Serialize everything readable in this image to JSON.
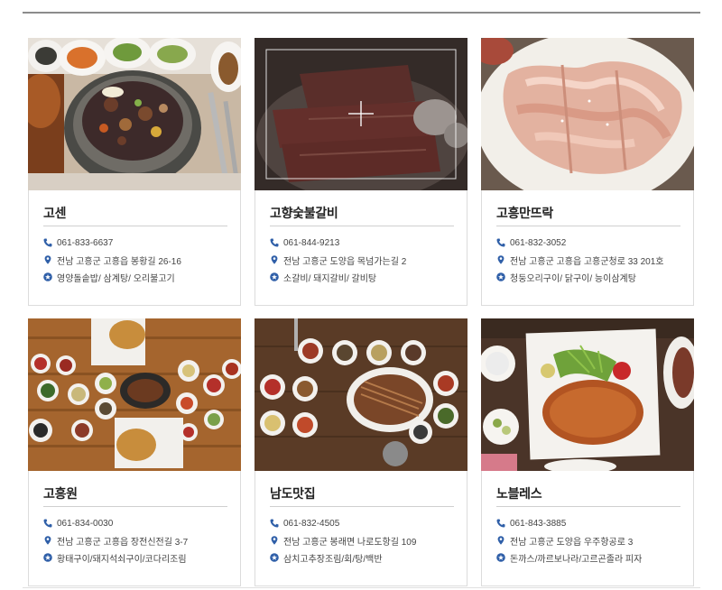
{
  "colors": {
    "accent": "#2f5fa8",
    "rule": "#8c8c8c",
    "border": "#dcdcdc"
  },
  "restaurants": [
    {
      "name": "고센",
      "phone": "061-833-6637",
      "address": "전남 고흥군 고흥읍 봉황길 26-16",
      "menu": "영양돌솥밥/ 삼계탕/ 오리불고기",
      "photo": "stone-pot-rice-photo"
    },
    {
      "name": "고향숯불갈비",
      "phone": "061-844-9213",
      "address": "전남 고흥군 도양읍 목넘가는길 2",
      "menu": "소갈비/ 돼지갈비/ 갈비탕",
      "photo": "raw-beef-ribs-photo"
    },
    {
      "name": "고흥만뜨락",
      "phone": "061-832-3052",
      "address": "전남 고흥군 고흥읍 고흥군청로 33 201호",
      "menu": "청둥오리구이/ 닭구이/ 능이삼계탕",
      "photo": "raw-duck-meat-photo"
    },
    {
      "name": "고흥원",
      "phone": "061-834-0030",
      "address": "전남 고흥군 고흥읍 장전신전길 3-7",
      "menu": "황태구이/돼지석쇠구이/코다리조림",
      "photo": "korean-table-spread-photo"
    },
    {
      "name": "남도맛집",
      "phone": "061-832-4505",
      "address": "전남 고흥군 봉래면 나로도항길 109",
      "menu": "삼치고추장조림/회/탕/백반",
      "photo": "grilled-eel-table-photo"
    },
    {
      "name": "노블레스",
      "phone": "061-843-3885",
      "address": "전남 고흥군 도양읍 우주항공로 3",
      "menu": "돈까스/까르보나라/고르곤졸라 피자",
      "photo": "pork-cutlet-plate-photo"
    }
  ],
  "icons": {
    "phone": "phone-icon",
    "address": "map-pin-icon",
    "menu": "star-badge-icon"
  }
}
